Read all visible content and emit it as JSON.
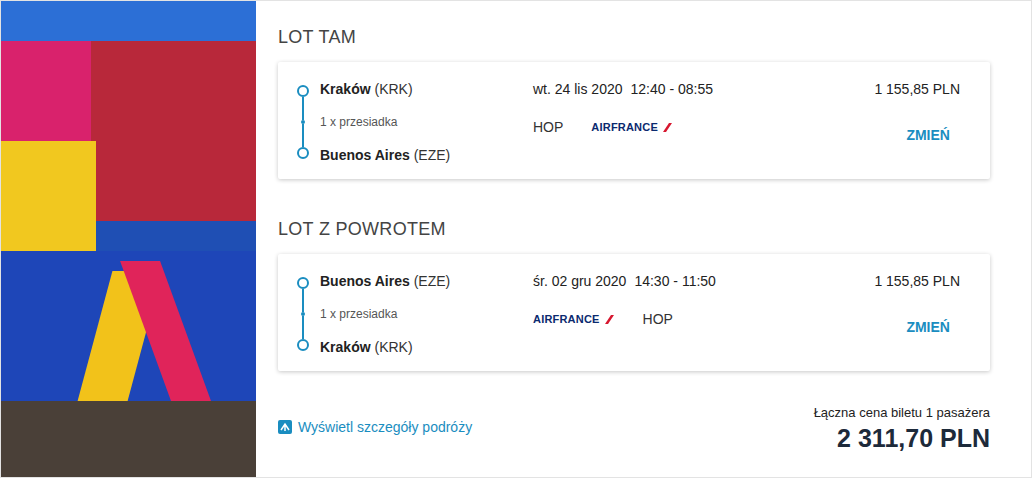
{
  "flights": [
    {
      "heading": "LOT TAM",
      "from": "Kraków",
      "from_code": "(KRK)",
      "stops": "1 x przesiadka",
      "to": "Buenos Aires",
      "to_code": "(EZE)",
      "date": "wt. 24 lis 2020",
      "time": "12:40 - 08:55",
      "carriers": [
        {
          "kind": "text",
          "label": "HOP"
        },
        {
          "kind": "logo",
          "label": "AIRFRANCE"
        }
      ],
      "price": "1 155,85 PLN",
      "change": "ZMIEŃ"
    },
    {
      "heading": "LOT Z POWROTEM",
      "from": "Buenos Aires",
      "from_code": "(EZE)",
      "stops": "1 x przesiadka",
      "to": "Kraków",
      "to_code": "(KRK)",
      "date": "śr. 02 gru 2020",
      "time": "14:30 - 11:50",
      "carriers": [
        {
          "kind": "logo",
          "label": "AIRFRANCE"
        },
        {
          "kind": "text",
          "label": "HOP"
        }
      ],
      "price": "1 155,85 PLN",
      "change": "ZMIEŃ"
    }
  ],
  "details_link": "Wyświetl szczegóły podróży",
  "total": {
    "label": "Łączna cena biletu 1 pasażera",
    "value": "2 311,70 PLN"
  }
}
